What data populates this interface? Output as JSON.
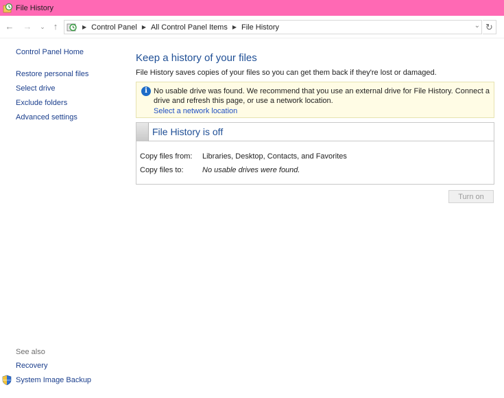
{
  "window": {
    "title": "File History",
    "title_bar_color": "#ff69b4"
  },
  "navigation": {
    "back_icon": "arrow-left-icon",
    "forward_icon": "arrow-right-icon",
    "recent_icon": "chevron-down-icon",
    "up_icon": "arrow-up-icon",
    "breadcrumbs": [
      "Control Panel",
      "All Control Panel Items",
      "File History"
    ],
    "refresh_icon": "refresh-icon"
  },
  "sidebar": {
    "home": "Control Panel Home",
    "items": [
      "Restore personal files",
      "Select drive",
      "Exclude folders",
      "Advanced settings"
    ],
    "see_also_label": "See also",
    "see_also": [
      "Recovery",
      "System Image Backup"
    ]
  },
  "main": {
    "title": "Keep a history of your files",
    "description": "File History saves copies of your files so you can get them back if they're lost or damaged.",
    "warning": {
      "message": "No usable drive was found. We recommend that you use an external drive for File History. Connect a drive and refresh this page, or use a network location.",
      "link": "Select a network location",
      "background": "#fffce5"
    },
    "status": {
      "title": "File History is off",
      "copy_from_label": "Copy files from:",
      "copy_from_value": "Libraries, Desktop, Contacts, and Favorites",
      "copy_to_label": "Copy files to:",
      "copy_to_value": "No usable drives were found."
    },
    "turn_on_button": "Turn on"
  },
  "colors": {
    "link": "#1a3e8c",
    "heading": "#1e4e95",
    "info": "#1e6cc8"
  }
}
